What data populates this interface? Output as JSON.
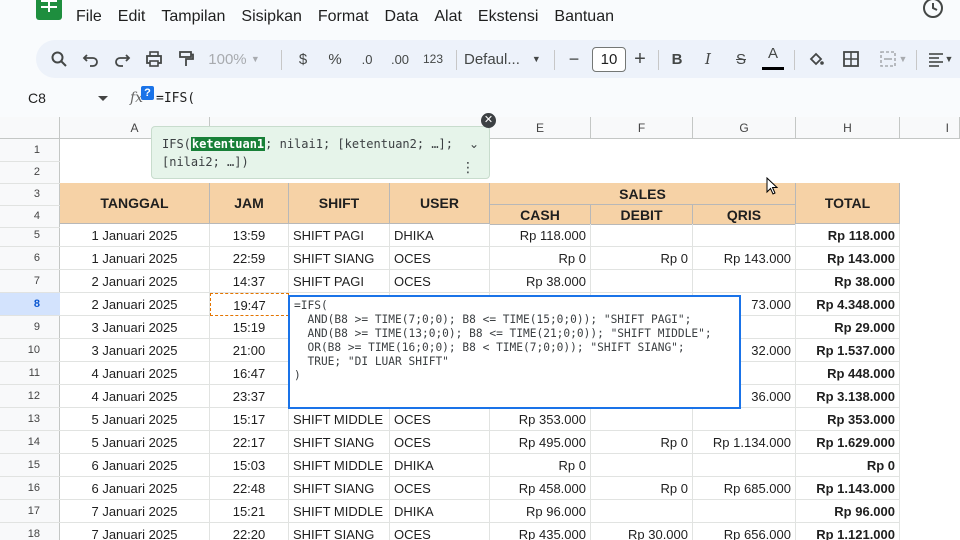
{
  "menu": {
    "items": [
      "File",
      "Edit",
      "Tampilan",
      "Sisipkan",
      "Format",
      "Data",
      "Alat",
      "Ekstensi",
      "Bantuan"
    ]
  },
  "toolbar": {
    "zoom": "100%",
    "currency": "$",
    "percent": "%",
    "dec_decrease": ".0",
    "dec_increase": ".00",
    "number_format": "123",
    "font": "Defaul...",
    "font_size": "10",
    "minus": "−",
    "plus": "+",
    "bold": "B",
    "italic": "I",
    "strike": "S",
    "text_color": "A"
  },
  "formula_bar": {
    "cell_ref": "C8",
    "fx_help": "?",
    "content": "=IFS("
  },
  "columns": [
    "A",
    "E",
    "F",
    "G",
    "H",
    "I"
  ],
  "rows": [
    "1",
    "2",
    "3",
    "4",
    "5",
    "6",
    "7",
    "8",
    "9",
    "10",
    "11",
    "12",
    "13",
    "14",
    "15",
    "16",
    "17",
    "18"
  ],
  "headers": {
    "tanggal": "TANGGAL",
    "jam": "JAM",
    "shift": "SHIFT",
    "user": "USER",
    "sales": "SALES",
    "cash": "CASH",
    "debit": "DEBIT",
    "qris": "QRIS",
    "total": "TOTAL"
  },
  "table": [
    {
      "tanggal": "1 Januari 2025",
      "jam": "13:59",
      "shift": "SHIFT PAGI",
      "user": "DHIKA",
      "cash": "Rp 118.000",
      "debit": "",
      "qris": "",
      "total": "Rp 118.000"
    },
    {
      "tanggal": "1 Januari 2025",
      "jam": "22:59",
      "shift": "SHIFT SIANG",
      "user": "OCES",
      "cash": "Rp 0",
      "debit": "Rp 0",
      "qris": "Rp 143.000",
      "total": "Rp 143.000"
    },
    {
      "tanggal": "2 Januari 2025",
      "jam": "14:37",
      "shift": "SHIFT PAGI",
      "user": "OCES",
      "cash": "Rp 38.000",
      "debit": "",
      "qris": "",
      "total": "Rp 38.000"
    },
    {
      "tanggal": "2 Januari 2025",
      "jam": "19:47",
      "shift": "",
      "user": "",
      "cash": "",
      "debit": "",
      "qris": "73.000",
      "total": "Rp 4.348.000"
    },
    {
      "tanggal": "3 Januari 2025",
      "jam": "15:19",
      "shift": "",
      "user": "",
      "cash": "",
      "debit": "",
      "qris": "",
      "total": "Rp 29.000"
    },
    {
      "tanggal": "3 Januari 2025",
      "jam": "21:00",
      "shift": "",
      "user": "",
      "cash": "",
      "debit": "",
      "qris": "32.000",
      "total": "Rp 1.537.000"
    },
    {
      "tanggal": "4 Januari 2025",
      "jam": "16:47",
      "shift": "",
      "user": "",
      "cash": "",
      "debit": "",
      "qris": "",
      "total": "Rp 448.000"
    },
    {
      "tanggal": "4 Januari 2025",
      "jam": "23:37",
      "shift": "",
      "user": "",
      "cash": "",
      "debit": "",
      "qris": "36.000",
      "total": "Rp 3.138.000"
    },
    {
      "tanggal": "5 Januari 2025",
      "jam": "15:17",
      "shift": "SHIFT MIDDLE",
      "user": "OCES",
      "cash": "Rp 353.000",
      "debit": "",
      "qris": "",
      "total": "Rp 353.000"
    },
    {
      "tanggal": "5 Januari 2025",
      "jam": "22:17",
      "shift": "SHIFT SIANG",
      "user": "OCES",
      "cash": "Rp 495.000",
      "debit": "Rp 0",
      "qris": "Rp 1.134.000",
      "total": "Rp 1.629.000"
    },
    {
      "tanggal": "6 Januari 2025",
      "jam": "15:03",
      "shift": "SHIFT MIDDLE",
      "user": "DHIKA",
      "cash": "Rp 0",
      "debit": "",
      "qris": "",
      "total": "Rp 0"
    },
    {
      "tanggal": "6 Januari 2025",
      "jam": "22:48",
      "shift": "SHIFT SIANG",
      "user": "OCES",
      "cash": "Rp 458.000",
      "debit": "Rp 0",
      "qris": "Rp 685.000",
      "total": "Rp 1.143.000"
    },
    {
      "tanggal": "7 Januari 2025",
      "jam": "15:21",
      "shift": "SHIFT MIDDLE",
      "user": "DHIKA",
      "cash": "Rp 96.000",
      "debit": "",
      "qris": "",
      "total": "Rp 96.000"
    },
    {
      "tanggal": "7 Januari 2025",
      "jam": "22:20",
      "shift": "SHIFT SIANG",
      "user": "OCES",
      "cash": "Rp 435.000",
      "debit": "Rp 30.000",
      "qris": "Rp 656.000",
      "total": "Rp 1.121.000"
    }
  ],
  "autocomplete": {
    "fn": "IFS(",
    "arg_active": "ketentuan1",
    "rest_line1": "; nilai1; [ketentuan2; …];",
    "line2": "[nilai2; …])"
  },
  "editor": {
    "line1": "=IFS(",
    "line2": "  AND(B8 >= TIME(7;0;0); B8 <= TIME(15;0;0)); \"SHIFT PAGI\";",
    "line3": "  AND(B8 >= TIME(13;0;0); B8 <= TIME(21;0;0)); \"SHIFT MIDDLE\";",
    "line4": "  OR(B8 >= TIME(16;0;0); B8 < TIME(7;0;0)); \"SHIFT SIANG\";",
    "line5": "  TRUE; \"DI LUAR SHIFT\"",
    "line6": ")"
  },
  "colors": {
    "header_fill": "#f6d2a6",
    "selection_blue": "#1a73e8",
    "autocomplete_bg": "#e6f4ea"
  }
}
